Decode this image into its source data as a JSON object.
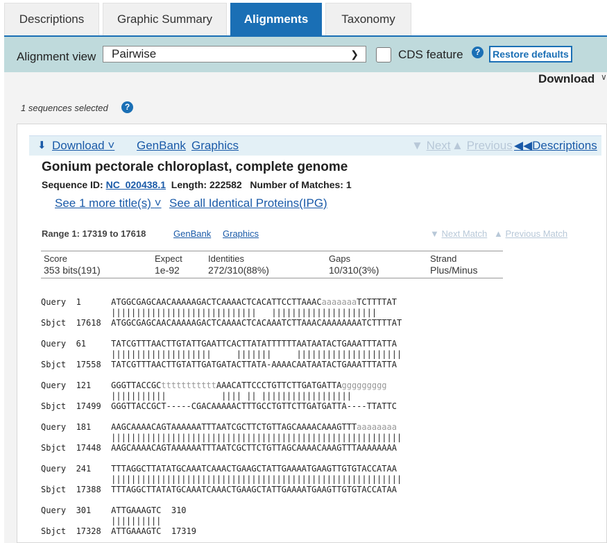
{
  "tabs": [
    "Descriptions",
    "Graphic Summary",
    "Alignments",
    "Taxonomy"
  ],
  "toolbar": {
    "view_label": "Alignment view",
    "view_value": "Pairwise",
    "cds_label": "CDS feature",
    "restore_label": "Restore defaults"
  },
  "download_top": "Download",
  "selected_text": "1 sequences selected",
  "linkbar": {
    "download": "Download",
    "genbank": "GenBank",
    "graphics": "Graphics",
    "next": "Next",
    "previous": "Previous",
    "descriptions": "Descriptions"
  },
  "hit": {
    "title": "Gonium pectorale chloroplast, complete genome",
    "seqid_label": "Sequence ID:",
    "seqid": "NC_020438.1",
    "length_label": "Length:",
    "length": "222582",
    "matches_label": "Number of Matches:",
    "matches": "1",
    "more_titles": "See 1 more title(s)",
    "ipg": "See all Identical Proteins(IPG)"
  },
  "range": {
    "label": "Range 1: 17319 to 17618",
    "genbank": "GenBank",
    "graphics": "Graphics",
    "next_match": "Next Match",
    "prev_match": "Previous Match"
  },
  "stats": {
    "headers": [
      "Score",
      "Expect",
      "Identities",
      "Gaps",
      "Strand"
    ],
    "values": [
      "353 bits(191)",
      "1e-92",
      "272/310(88%)",
      "10/310(3%)",
      "Plus/Minus"
    ]
  },
  "alignment": [
    {
      "q": "Query  1      ATGGCGAGCAACAAAAAGACTCAAAACTCACATTCCTTAAAC",
      "qlc": "aaaaaaa",
      "qrest": "TCTTTTAT",
      "m": "              |||||||||||||||||||||||||||||   |||||||||||||||||||||",
      "s": "Sbjct  17618  ATGGCGAGCAACAAAAAGACTCAAAACTCACAAATCTTAAACAAAAAAAATCTTTTAT"
    },
    {
      "q": "Query  61     TATCGTTTAACTTGTATTGAATTCACTTATATTTTTTAATAATACTGAAATTTATTA",
      "qlc": "",
      "qrest": "",
      "m": "              ||||||||||||||||||||     |||||||     |||||||||||||||||||||",
      "s": "Sbjct  17558  TATCGTTTAACTTGTATTGATGATACTTATA-AAAACAATAATACTGAAATTTATTA"
    },
    {
      "q": "Query  121    GGGTTACCGC",
      "qlc": "ttttttttttt",
      "qrest": "AAACATTCCCTGTTCTTGATGATTA",
      "qlc2": "ggggggggg",
      "m": "              |||||||||||           |||| || ||||||||||||||||||",
      "s": "Sbjct  17499  GGGTTACCGCT-----CGACAAAAACTTTGCCTGTTCTTGATGATTA----TTATTC"
    },
    {
      "q": "Query  181    AAGCAAAACAGTAAAAAATTTAATCGCTTCTGTTAGCAAAACAAAGTTT",
      "qlc": "aaaaaaaa",
      "qrest": "",
      "m": "              ||||||||||||||||||||||||||||||||||||||||||||||||||||||||||",
      "s": "Sbjct  17448  AAGCAAAACAGTAAAAAATTTAATCGCTTCTGTTAGCAAAACAAAGTTTAAAAAAAA"
    },
    {
      "q": "Query  241    TTTAGGCTTATATGCAAATCAAACTGAAGCTATTGAAAATGAAGTTGTGTACCATAA",
      "qlc": "",
      "qrest": "",
      "m": "              ||||||||||||||||||||||||||||||||||||||||||||||||||||||||||",
      "s": "Sbjct  17388  TTTAGGCTTATATGCAAATCAAACTGAAGCTATTGAAAATGAAGTTGTGTACCATAA"
    },
    {
      "q": "Query  301    ATTGAAAGTC  310",
      "qlc": "",
      "qrest": "",
      "m": "              ||||||||||",
      "s": "Sbjct  17328  ATTGAAAGTC  17319"
    }
  ]
}
